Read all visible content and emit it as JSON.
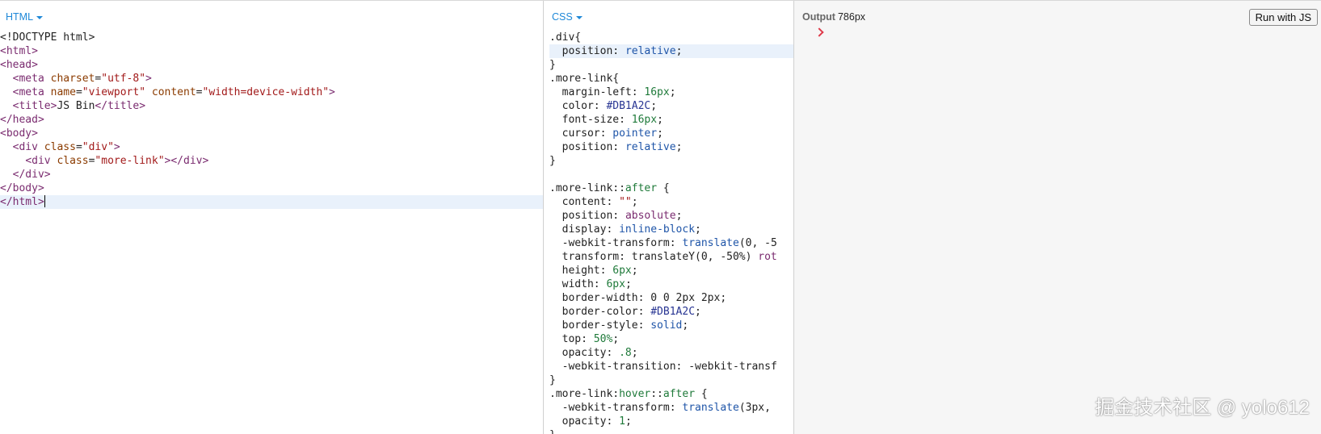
{
  "html_panel": {
    "label": "HTML",
    "lines": [
      [
        {
          "t": "<!DOCTYPE html>",
          "c": ""
        }
      ],
      [
        {
          "t": "<html>",
          "c": "tag"
        }
      ],
      [
        {
          "t": "<head>",
          "c": "tag"
        }
      ],
      [
        {
          "t": "  ",
          "c": ""
        },
        {
          "t": "<meta ",
          "c": "tag"
        },
        {
          "t": "charset",
          "c": "attr"
        },
        {
          "t": "=",
          "c": ""
        },
        {
          "t": "\"utf-8\"",
          "c": "str"
        },
        {
          "t": ">",
          "c": "tag"
        }
      ],
      [
        {
          "t": "  ",
          "c": ""
        },
        {
          "t": "<meta ",
          "c": "tag"
        },
        {
          "t": "name",
          "c": "attr"
        },
        {
          "t": "=",
          "c": ""
        },
        {
          "t": "\"viewport\"",
          "c": "str"
        },
        {
          "t": " ",
          "c": ""
        },
        {
          "t": "content",
          "c": "attr"
        },
        {
          "t": "=",
          "c": ""
        },
        {
          "t": "\"width=device-width\"",
          "c": "str"
        },
        {
          "t": ">",
          "c": "tag"
        }
      ],
      [
        {
          "t": "  ",
          "c": ""
        },
        {
          "t": "<title>",
          "c": "tag"
        },
        {
          "t": "JS Bin",
          "c": ""
        },
        {
          "t": "</title>",
          "c": "tag"
        }
      ],
      [
        {
          "t": "</head>",
          "c": "tag"
        }
      ],
      [
        {
          "t": "<body>",
          "c": "tag"
        }
      ],
      [
        {
          "t": "  ",
          "c": ""
        },
        {
          "t": "<div ",
          "c": "tag"
        },
        {
          "t": "class",
          "c": "attr"
        },
        {
          "t": "=",
          "c": ""
        },
        {
          "t": "\"div\"",
          "c": "str"
        },
        {
          "t": ">",
          "c": "tag"
        }
      ],
      [
        {
          "t": "    ",
          "c": ""
        },
        {
          "t": "<div ",
          "c": "tag"
        },
        {
          "t": "class",
          "c": "attr"
        },
        {
          "t": "=",
          "c": ""
        },
        {
          "t": "\"more-link\"",
          "c": "str"
        },
        {
          "t": "></div>",
          "c": "tag"
        }
      ],
      [
        {
          "t": "  ",
          "c": ""
        },
        {
          "t": "</div>",
          "c": "tag"
        }
      ],
      [
        {
          "t": "</body>",
          "c": "tag"
        }
      ],
      [
        {
          "t": "</html>",
          "c": "tag"
        }
      ]
    ],
    "highlight_line": 12,
    "cursor_line": 12
  },
  "css_panel": {
    "label": "CSS",
    "lines": [
      [
        {
          "t": ".div{",
          "c": "sel"
        }
      ],
      [
        {
          "t": "  position",
          "c": "prop"
        },
        {
          "t": ": ",
          "c": ""
        },
        {
          "t": "relative",
          "c": "fn"
        },
        {
          "t": ";",
          "c": ""
        }
      ],
      [
        {
          "t": "}",
          "c": ""
        }
      ],
      [
        {
          "t": ".more-link{",
          "c": "sel"
        }
      ],
      [
        {
          "t": "  margin-left",
          "c": "prop"
        },
        {
          "t": ": ",
          "c": ""
        },
        {
          "t": "16px",
          "c": "num"
        },
        {
          "t": ";",
          "c": ""
        }
      ],
      [
        {
          "t": "  color",
          "c": "prop"
        },
        {
          "t": ": ",
          "c": ""
        },
        {
          "t": "#DB1A2C",
          "c": "hex"
        },
        {
          "t": ";",
          "c": ""
        }
      ],
      [
        {
          "t": "  font-size",
          "c": "prop"
        },
        {
          "t": ": ",
          "c": ""
        },
        {
          "t": "16px",
          "c": "num"
        },
        {
          "t": ";",
          "c": ""
        }
      ],
      [
        {
          "t": "  cursor",
          "c": "prop"
        },
        {
          "t": ": ",
          "c": ""
        },
        {
          "t": "pointer",
          "c": "fn"
        },
        {
          "t": ";",
          "c": ""
        }
      ],
      [
        {
          "t": "  position",
          "c": "prop"
        },
        {
          "t": ": ",
          "c": ""
        },
        {
          "t": "relative",
          "c": "fn"
        },
        {
          "t": ";",
          "c": ""
        }
      ],
      [
        {
          "t": "}",
          "c": ""
        }
      ],
      [
        {
          "t": "",
          "c": ""
        }
      ],
      [
        {
          "t": ".more-link::",
          "c": "sel"
        },
        {
          "t": "after",
          "c": "num"
        },
        {
          "t": " {",
          "c": ""
        }
      ],
      [
        {
          "t": "  content",
          "c": "prop"
        },
        {
          "t": ": ",
          "c": ""
        },
        {
          "t": "\"\"",
          "c": "str"
        },
        {
          "t": ";",
          "c": ""
        }
      ],
      [
        {
          "t": "  position",
          "c": "prop"
        },
        {
          "t": ": ",
          "c": ""
        },
        {
          "t": "absolute",
          "c": "kw"
        },
        {
          "t": ";",
          "c": ""
        }
      ],
      [
        {
          "t": "  display",
          "c": "prop"
        },
        {
          "t": ": ",
          "c": ""
        },
        {
          "t": "inline-block",
          "c": "fn"
        },
        {
          "t": ";",
          "c": ""
        }
      ],
      [
        {
          "t": "  -webkit-transform",
          "c": "prop"
        },
        {
          "t": ": ",
          "c": ""
        },
        {
          "t": "translate",
          "c": "fn"
        },
        {
          "t": "(0, -5",
          "c": ""
        }
      ],
      [
        {
          "t": "  transform",
          "c": "prop"
        },
        {
          "t": ": translateY(0, -50%) ",
          "c": ""
        },
        {
          "t": "rot",
          "c": "kw"
        }
      ],
      [
        {
          "t": "  height",
          "c": "prop"
        },
        {
          "t": ": ",
          "c": ""
        },
        {
          "t": "6px",
          "c": "num"
        },
        {
          "t": ";",
          "c": ""
        }
      ],
      [
        {
          "t": "  width",
          "c": "prop"
        },
        {
          "t": ": ",
          "c": ""
        },
        {
          "t": "6px",
          "c": "num"
        },
        {
          "t": ";",
          "c": ""
        }
      ],
      [
        {
          "t": "  border-width",
          "c": "prop"
        },
        {
          "t": ": 0 0 2px 2px;",
          "c": ""
        }
      ],
      [
        {
          "t": "  border-color",
          "c": "prop"
        },
        {
          "t": ": ",
          "c": ""
        },
        {
          "t": "#DB1A2C",
          "c": "hex"
        },
        {
          "t": ";",
          "c": ""
        }
      ],
      [
        {
          "t": "  border-style",
          "c": "prop"
        },
        {
          "t": ": ",
          "c": ""
        },
        {
          "t": "solid",
          "c": "fn"
        },
        {
          "t": ";",
          "c": ""
        }
      ],
      [
        {
          "t": "  top",
          "c": "prop"
        },
        {
          "t": ": ",
          "c": ""
        },
        {
          "t": "50%",
          "c": "num"
        },
        {
          "t": ";",
          "c": ""
        }
      ],
      [
        {
          "t": "  opacity",
          "c": "prop"
        },
        {
          "t": ": ",
          "c": ""
        },
        {
          "t": ".8",
          "c": "num"
        },
        {
          "t": ";",
          "c": ""
        }
      ],
      [
        {
          "t": "  -webkit-transition",
          "c": "prop"
        },
        {
          "t": ": -webkit-transf",
          "c": ""
        }
      ],
      [
        {
          "t": "}",
          "c": ""
        }
      ],
      [
        {
          "t": ".more-link:",
          "c": "sel"
        },
        {
          "t": "hover",
          "c": "num"
        },
        {
          "t": "::",
          "c": "sel"
        },
        {
          "t": "after",
          "c": "num"
        },
        {
          "t": " {",
          "c": ""
        }
      ],
      [
        {
          "t": "  -webkit-transform",
          "c": "prop"
        },
        {
          "t": ": ",
          "c": ""
        },
        {
          "t": "translate",
          "c": "fn"
        },
        {
          "t": "(3px,",
          "c": ""
        }
      ],
      [
        {
          "t": "  opacity",
          "c": "prop"
        },
        {
          "t": ": ",
          "c": ""
        },
        {
          "t": "1",
          "c": "num"
        },
        {
          "t": ";",
          "c": ""
        }
      ],
      [
        {
          "t": "}",
          "c": ""
        }
      ]
    ],
    "highlight_line": 1
  },
  "output_panel": {
    "label": "Output",
    "width_text": "786px",
    "run_button": "Run with JS",
    "preview_icon": "chevron-right-icon",
    "preview_color": "#DB1A2C"
  },
  "watermark": "掘金技术社区 @ yolo612"
}
